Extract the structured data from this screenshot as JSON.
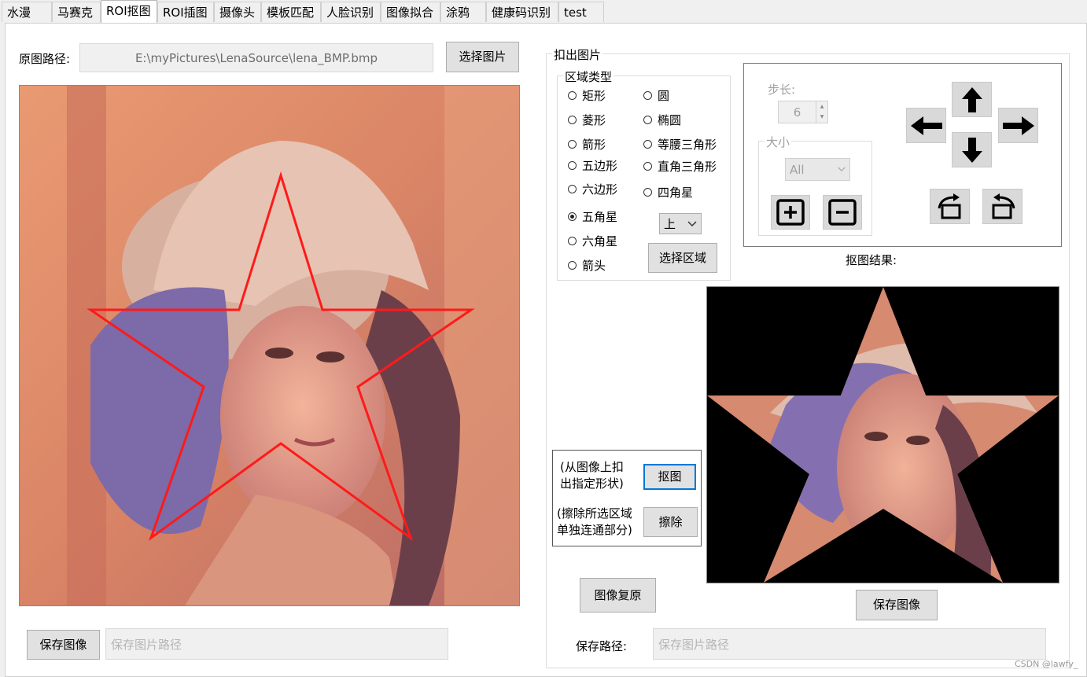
{
  "tabs": [
    "水漫",
    "马赛克",
    "ROI抠图",
    "ROI插图",
    "摄像头",
    "模板匹配",
    "人脸识别",
    "图像拟合",
    "涂鸦",
    "健康码识别",
    "test"
  ],
  "active_tab": "ROI抠图",
  "left": {
    "path_label": "原图路径:",
    "path_value": "E:\\myPictures\\LenaSource\\lena_BMP.bmp",
    "select_button": "选择图片",
    "save_button": "保存图像",
    "save_placeholder": "保存图片路径"
  },
  "extract": {
    "group_title": "扣出图片",
    "region_group_title": "区域类型",
    "shapes_left": [
      "矩形",
      "菱形",
      "箭形",
      "五边形",
      "六边形",
      "五角星",
      "六角星",
      "箭头"
    ],
    "shapes_right": [
      "圆",
      "椭圆",
      "等腰三角形",
      "直角三角形",
      "四角星"
    ],
    "selected_shape": "五角星",
    "direction_value": "上",
    "select_region_button": "选择区域",
    "step_label": "步长:",
    "step_value": "6",
    "size_group_title": "大小",
    "size_value": "All",
    "result_label": "抠图结果:",
    "crop_desc": "(从图像上扣出指定形状)",
    "crop_desc_line1": "(从图像上扣",
    "crop_desc_line2": "出指定形状)",
    "crop_button": "抠图",
    "erase_desc_line1": "(擦除所选区域",
    "erase_desc_line2": "单独连通部分)",
    "erase_button": "擦除",
    "restore_button": "图像复原",
    "save_button": "保存图像",
    "save_path_label": "保存路径:",
    "save_placeholder": "保存图片路径"
  },
  "icons": {
    "up": "arrow-up-icon",
    "down": "arrow-down-icon",
    "left": "arrow-left-icon",
    "right": "arrow-right-icon",
    "plus": "plus-box-icon",
    "minus": "minus-box-icon",
    "rotate_left": "rotate-ccw-icon",
    "rotate_right": "rotate-cw-icon"
  },
  "watermark": "CSDN @lawfy_",
  "colors": {
    "star_outline": "#ff1a1a",
    "focus": "#0078d7"
  }
}
